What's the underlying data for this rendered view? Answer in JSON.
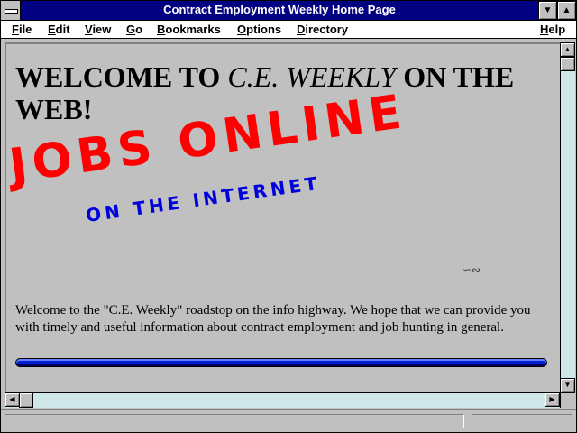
{
  "window": {
    "title": "Contract Employment Weekly Home Page"
  },
  "menubar": {
    "items": [
      {
        "key": "F",
        "rest": "ile"
      },
      {
        "key": "E",
        "rest": "dit"
      },
      {
        "key": "V",
        "rest": "iew"
      },
      {
        "key": "G",
        "rest": "o"
      },
      {
        "key": "B",
        "rest": "ookmarks"
      },
      {
        "key": "O",
        "rest": "ptions"
      },
      {
        "key": "D",
        "rest": "irectory"
      },
      {
        "key": "H",
        "rest": "elp"
      }
    ]
  },
  "page": {
    "heading_part1": "WELCOME TO ",
    "heading_italic": "C.E. WEEKLY",
    "heading_part2": " ON THE WEB!",
    "logo_main": "JOBS ONLINE",
    "logo_sub": "ON THE INTERNET",
    "paragraph": "Welcome to the \"C.E. Weekly\" roadstop on the info highway. We hope that we can provide you with timely and useful information about contract employment and job hunting in general."
  },
  "colors": {
    "titlebar": "#000080",
    "logo_main": "#ff0000",
    "logo_sub": "#0000dd",
    "bar": "#0020d0",
    "scroll_track": "#cfe7e8"
  }
}
